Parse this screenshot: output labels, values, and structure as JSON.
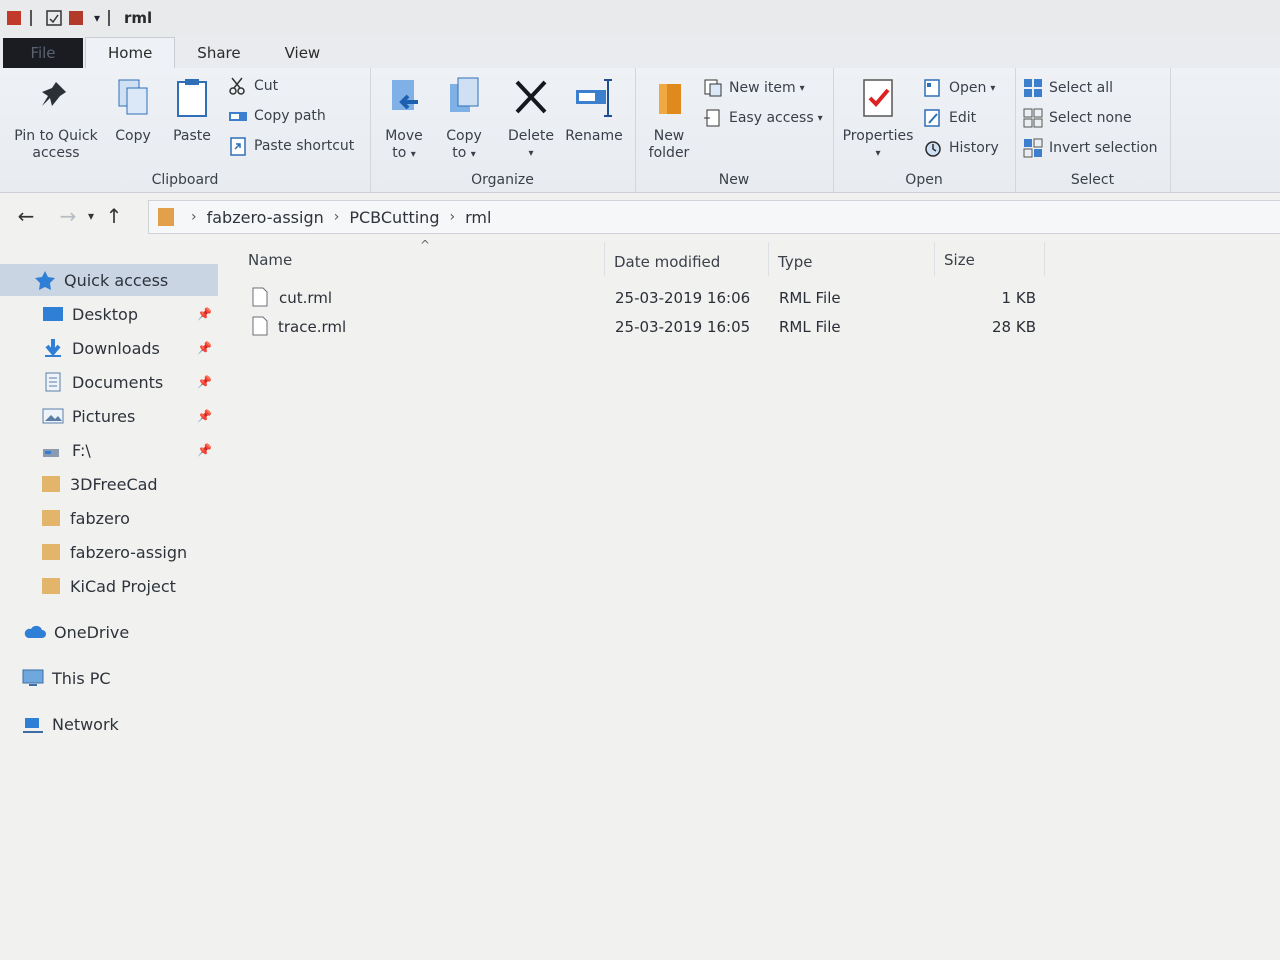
{
  "window": {
    "title": "rml"
  },
  "tabs": [
    "File",
    "Home",
    "Share",
    "View"
  ],
  "ribbon": {
    "clipboard": {
      "label": "Clipboard",
      "pin_line1": "Pin to Quick",
      "pin_line2": "access",
      "copy": "Copy",
      "paste": "Paste",
      "cut": "Cut",
      "copy_path": "Copy path",
      "paste_shortcut": "Paste shortcut"
    },
    "organize": {
      "label": "Organize",
      "move_line1": "Move",
      "move_line2": "to",
      "copy_line1": "Copy",
      "copy_line2": "to",
      "delete": "Delete",
      "rename": "Rename"
    },
    "new": {
      "label": "New",
      "folder_line1": "New",
      "folder_line2": "folder",
      "new_item": "New item",
      "easy_access": "Easy access"
    },
    "open": {
      "label": "Open",
      "properties": "Properties",
      "open": "Open",
      "edit": "Edit",
      "history": "History"
    },
    "select": {
      "label": "Select",
      "select_all": "Select all",
      "select_none": "Select none",
      "invert_selection": "Invert selection"
    }
  },
  "address": {
    "breadcrumbs": [
      "fabzero-assign",
      "PCBCutting",
      "rml"
    ]
  },
  "nav": {
    "quick_access": "Quick access",
    "pinned": [
      "Desktop",
      "Downloads",
      "Documents",
      "Pictures",
      "F:\\"
    ],
    "folders": [
      "3DFreeCad",
      "fabzero",
      "fabzero-assign",
      "KiCad Project"
    ],
    "onedrive": "OneDrive",
    "this_pc": "This PC",
    "network": "Network"
  },
  "columns": {
    "name": "Name",
    "date": "Date modified",
    "type": "Type",
    "size": "Size"
  },
  "files": [
    {
      "name": "cut.rml",
      "date": "25-03-2019 16:06",
      "type": "RML File",
      "size": "1 KB"
    },
    {
      "name": "trace.rml",
      "date": "25-03-2019 16:05",
      "type": "RML File",
      "size": "28 KB"
    }
  ],
  "colors": {
    "accent": "#2f7fd6",
    "selection": "#c9d5e3",
    "folder": "#e2b56a"
  }
}
